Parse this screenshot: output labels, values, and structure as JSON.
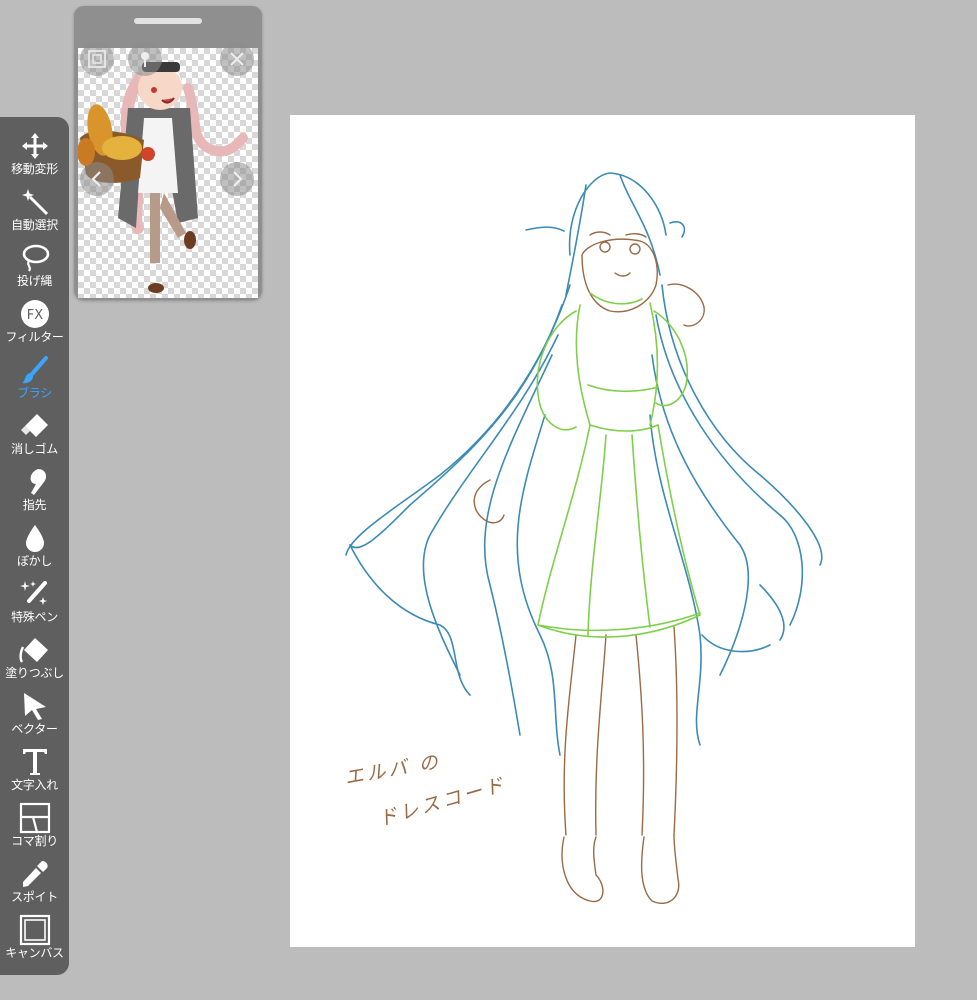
{
  "toolbar": {
    "tools": [
      {
        "id": "move",
        "label": "移動変形",
        "icon": "move-arrows-icon"
      },
      {
        "id": "magic",
        "label": "自動選択",
        "icon": "magic-wand-icon"
      },
      {
        "id": "lasso",
        "label": "投げ縄",
        "icon": "lasso-icon"
      },
      {
        "id": "filter",
        "label": "フィルター",
        "icon": "fx-icon"
      },
      {
        "id": "brush",
        "label": "ブラシ",
        "icon": "brush-icon",
        "active": true
      },
      {
        "id": "eraser",
        "label": "消しゴム",
        "icon": "eraser-icon"
      },
      {
        "id": "smudge",
        "label": "指先",
        "icon": "finger-icon"
      },
      {
        "id": "blur",
        "label": "ぼかし",
        "icon": "drop-icon"
      },
      {
        "id": "special",
        "label": "特殊ペン",
        "icon": "sparkle-pen-icon"
      },
      {
        "id": "fill",
        "label": "塗りつぶし",
        "icon": "bucket-icon"
      },
      {
        "id": "vector",
        "label": "ベクター",
        "icon": "cursor-arrow-icon"
      },
      {
        "id": "text",
        "label": "文字入れ",
        "icon": "text-t-icon"
      },
      {
        "id": "frame",
        "label": "コマ割り",
        "icon": "panels-icon"
      },
      {
        "id": "eyedropper",
        "label": "スポイト",
        "icon": "eyedropper-icon"
      },
      {
        "id": "canvas",
        "label": "キャンバス",
        "icon": "canvas-icon"
      }
    ],
    "active_color": "#3ba4ff"
  },
  "reference": {
    "icons": [
      "fit-icon",
      "pin-icon",
      "close-icon",
      "prev-icon",
      "next-icon"
    ]
  },
  "canvas": {
    "note_line1": "エルバ の",
    "note_line2": "ドレスコード"
  },
  "colors": {
    "hair": "#3b8bb5",
    "dress": "#7fcf4a",
    "skin": "#9a6a46"
  }
}
